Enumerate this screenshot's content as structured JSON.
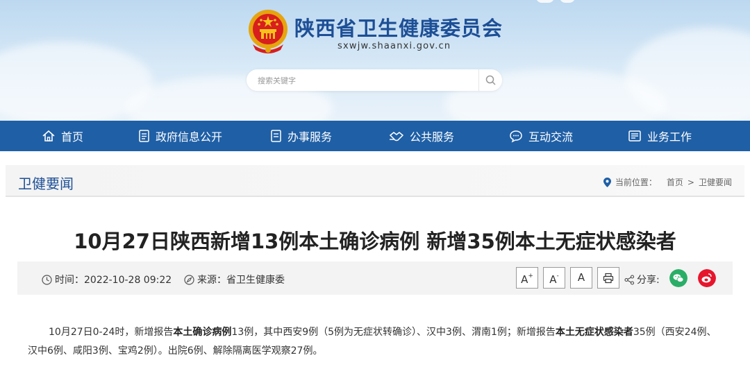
{
  "header": {
    "site_title": "陕西省卫生健康委员会",
    "site_domain": "sxwjw.shaanxi.gov.cn",
    "search_placeholder": "搜索关键字"
  },
  "nav": {
    "items": [
      {
        "label": "首页",
        "icon": "home-icon"
      },
      {
        "label": "政府信息公开",
        "icon": "document-icon"
      },
      {
        "label": "办事服务",
        "icon": "list-icon"
      },
      {
        "label": "公共服务",
        "icon": "handshake-icon"
      },
      {
        "label": "互动交流",
        "icon": "chat-icon"
      },
      {
        "label": "业务工作",
        "icon": "briefcase-icon"
      }
    ]
  },
  "breadcrumb": {
    "section_title": "卫健要闻",
    "location_label": "当前位置：",
    "home": "首页",
    "separator": ">",
    "current": "卫健要闻"
  },
  "article": {
    "title": "10月27日陕西新增13例本土确诊病例 新增35例本土无症状感染者",
    "time_label": "时间：2022-10-28 09:22",
    "source_label": "来源：省卫生健康委",
    "font_large": "A",
    "font_small": "A",
    "font_normal": "A",
    "share_label": "分享:",
    "body": {
      "p1_a": "10月27日0-24时，新增报告",
      "p1_b": "本土确诊病例",
      "p1_c": "13例，其中西安9例（5例为无症状转确诊）、汉中3例、渭南1例；新增报告",
      "p1_d": "本土无症状感染者",
      "p1_e": "35例（西安24例、汉中6例、咸阳3例、宝鸡2例）。出院6例、解除隔离医学观察27例。"
    }
  },
  "colors": {
    "nav_bg": "#1f5fa6",
    "title_blue": "#1d4f96",
    "wechat": "#2aae67",
    "weibo": "#e6162d"
  }
}
